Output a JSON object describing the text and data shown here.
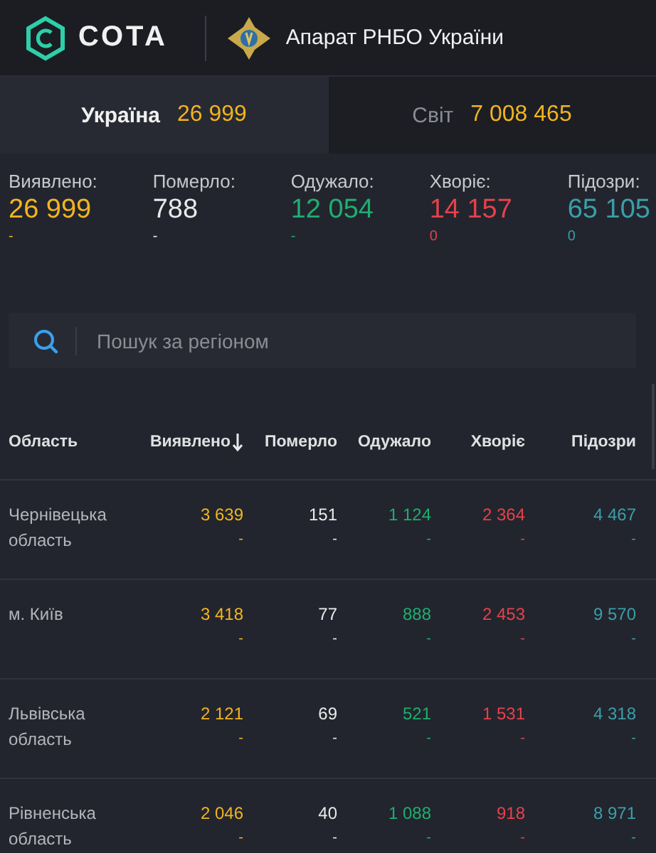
{
  "header": {
    "logo_text": "СОТА",
    "organization": "Апарат РНБО України"
  },
  "tabs": [
    {
      "label": "Україна",
      "count": "26 999",
      "selected": true
    },
    {
      "label": "Світ",
      "count": "7 008 465",
      "selected": false
    }
  ],
  "stats": [
    {
      "kind": "confirmed",
      "label": "Виявлено:",
      "value": "26 999",
      "delta": "-"
    },
    {
      "kind": "deaths",
      "label": "Померло:",
      "value": "788",
      "delta": "-"
    },
    {
      "kind": "recovered",
      "label": "Одужало:",
      "value": "12 054",
      "delta": "-"
    },
    {
      "kind": "sick",
      "label": "Хворіє:",
      "value": "14 157",
      "delta": "0"
    },
    {
      "kind": "suspected",
      "label": "Підозри:",
      "value": "65 105",
      "delta": "0"
    }
  ],
  "search": {
    "placeholder": "Пошук за регіоном"
  },
  "table": {
    "columns": [
      {
        "kind": "name",
        "label": "Область",
        "sorted": false
      },
      {
        "kind": "confirmed",
        "label": "Виявлено",
        "sorted": true
      },
      {
        "kind": "deaths",
        "label": "Померло",
        "sorted": false
      },
      {
        "kind": "recovered",
        "label": "Одужало",
        "sorted": false
      },
      {
        "kind": "sick",
        "label": "Хворіє",
        "sorted": false
      },
      {
        "kind": "suspected",
        "label": "Підозри",
        "sorted": false
      }
    ],
    "rows": [
      {
        "cells": [
          {
            "value": "Чернівецька область"
          },
          {
            "value": "3 639",
            "delta": "-"
          },
          {
            "value": "151",
            "delta": "-"
          },
          {
            "value": "1 124",
            "delta": "-"
          },
          {
            "value": "2 364",
            "delta": "-"
          },
          {
            "value": "4 467",
            "delta": "-"
          }
        ]
      },
      {
        "cells": [
          {
            "value": "м. Київ"
          },
          {
            "value": "3 418",
            "delta": "-"
          },
          {
            "value": "77",
            "delta": "-"
          },
          {
            "value": "888",
            "delta": "-"
          },
          {
            "value": "2 453",
            "delta": "-"
          },
          {
            "value": "9 570",
            "delta": "-"
          }
        ]
      },
      {
        "cells": [
          {
            "value": "Львівська область"
          },
          {
            "value": "2 121",
            "delta": "-"
          },
          {
            "value": "69",
            "delta": "-"
          },
          {
            "value": "521",
            "delta": "-"
          },
          {
            "value": "1 531",
            "delta": "-"
          },
          {
            "value": "4 318",
            "delta": "-"
          }
        ]
      },
      {
        "cells": [
          {
            "value": "Рівненська область"
          },
          {
            "value": "2 046",
            "delta": "-"
          },
          {
            "value": "40",
            "delta": "-"
          },
          {
            "value": "1 088",
            "delta": "-"
          },
          {
            "value": "918",
            "delta": "-"
          },
          {
            "value": "8 971",
            "delta": "-"
          }
        ]
      }
    ]
  }
}
